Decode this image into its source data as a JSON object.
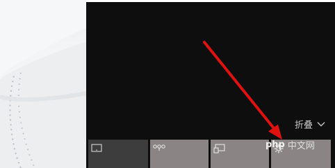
{
  "action_center": {
    "collapse_label": "折叠",
    "tiles": [
      {
        "icon": "tablet-mode-icon",
        "state": "off"
      },
      {
        "icon": "network-icon",
        "state": "on"
      },
      {
        "icon": "connect-display-icon",
        "state": "on"
      },
      {
        "icon": "settings-icon",
        "state": "on"
      }
    ]
  },
  "watermark": {
    "logo_text": "php",
    "site_text": "中文网"
  },
  "colors": {
    "panel_bg": "#0e0e0f",
    "tile_on": "#8a8584",
    "tile_off": "#3d3d3d",
    "annotation_arrow": "#e0120f"
  }
}
